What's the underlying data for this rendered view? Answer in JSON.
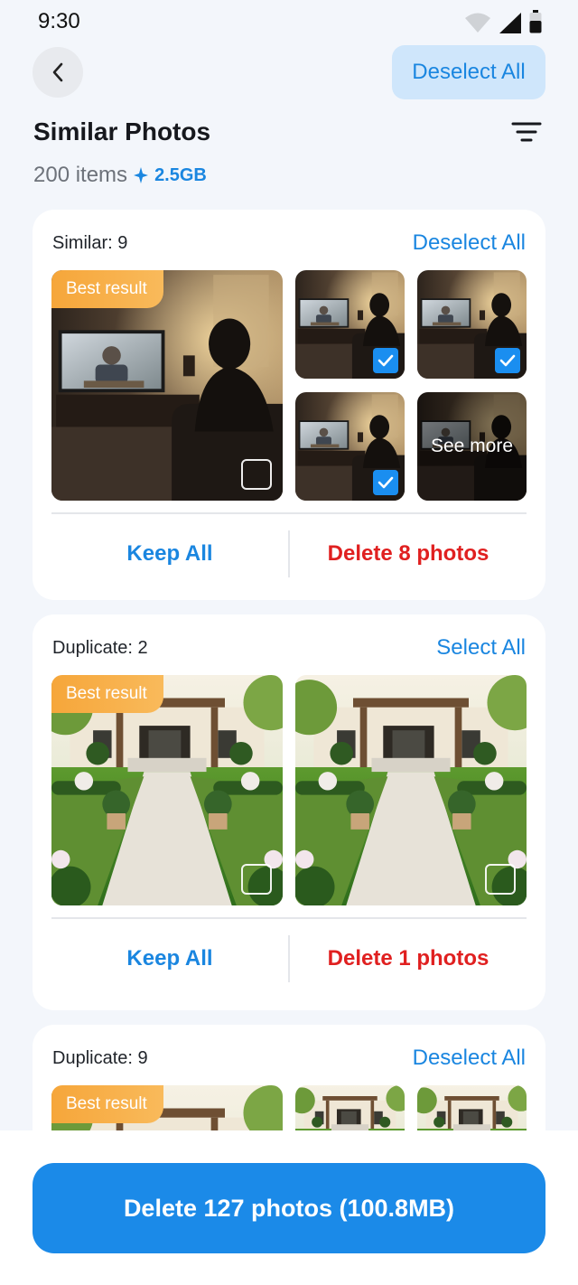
{
  "status_bar": {
    "time": "9:30"
  },
  "header": {
    "deselect_label": "Deselect All"
  },
  "page": {
    "title": "Similar Photos",
    "item_count": "200 items",
    "size": "2.5GB"
  },
  "groups": [
    {
      "label": "Similar: 9",
      "action": "Deselect All",
      "best_badge": "Best result",
      "see_more": "See more",
      "keep_label": "Keep All",
      "delete_label": "Delete 8 photos",
      "photos": [
        {
          "scene": "tv-room",
          "selected": false,
          "best": true
        },
        {
          "scene": "tv-room",
          "selected": true
        },
        {
          "scene": "tv-room",
          "selected": true
        },
        {
          "scene": "tv-room",
          "selected": true
        },
        {
          "scene": "tv-room",
          "selected": false,
          "see_more": true
        }
      ]
    },
    {
      "label": "Duplicate: 2",
      "action": "Select All",
      "best_badge": "Best result",
      "keep_label": "Keep All",
      "delete_label": "Delete 1 photos",
      "photos": [
        {
          "scene": "garden",
          "selected": false,
          "best": true
        },
        {
          "scene": "garden",
          "selected": false
        }
      ]
    },
    {
      "label": "Duplicate: 9",
      "action": "Deselect All",
      "best_badge": "Best result",
      "photos": [
        {
          "scene": "garden",
          "best": true
        },
        {
          "scene": "garden"
        },
        {
          "scene": "garden"
        }
      ]
    }
  ],
  "footer": {
    "delete_button": "Delete 127 photos (100.8MB)"
  },
  "colors": {
    "accent": "#1a86e0",
    "danger": "#e02020",
    "badge": "#f6a63a"
  }
}
